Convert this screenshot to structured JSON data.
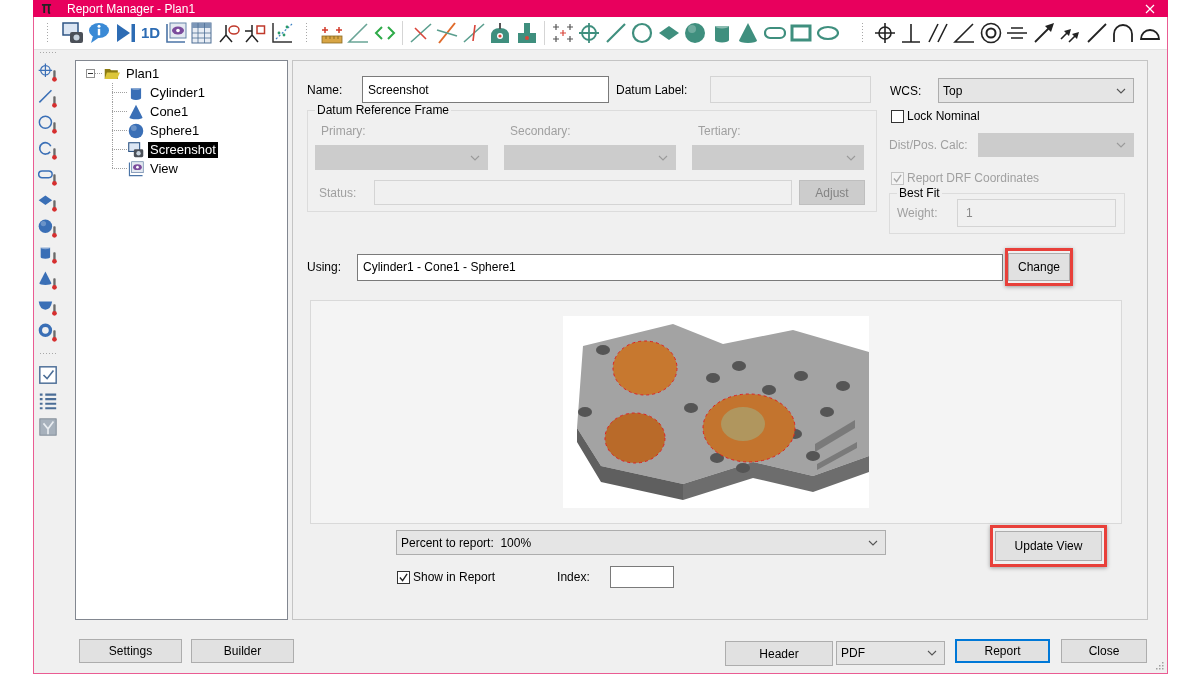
{
  "window": {
    "title": "Report Manager - Plan1"
  },
  "toolbar": {
    "one_d_button": "1D"
  },
  "tree": {
    "items": [
      {
        "label": "Plan1",
        "kind": "folder",
        "expanded": true,
        "selected": false,
        "children": [
          {
            "label": "Cylinder1",
            "kind": "cylinder",
            "selected": false
          },
          {
            "label": "Cone1",
            "kind": "cone",
            "selected": false
          },
          {
            "label": "Sphere1",
            "kind": "sphere",
            "selected": false
          },
          {
            "label": "Screenshot",
            "kind": "screenshot",
            "selected": true
          },
          {
            "label": "View",
            "kind": "view",
            "selected": false
          }
        ]
      }
    ]
  },
  "form": {
    "name": {
      "label": "Name:",
      "value": "Screenshot"
    },
    "datum_label": {
      "label": "Datum Label:",
      "disabled": true
    },
    "datum_reference_frame": {
      "title": "Datum Reference Frame",
      "disabled": true,
      "datums": [
        {
          "label": "Primary:"
        },
        {
          "label": "Secondary:"
        },
        {
          "label": "Tertiary:"
        }
      ],
      "status_label": "Status:",
      "adjust_button": "Adjust"
    },
    "wcs": {
      "label": "WCS:",
      "value": "Top"
    },
    "lock_nominal": {
      "label": "Lock Nominal",
      "checked": false
    },
    "dist_pos_calc": {
      "label": "Dist/Pos. Calc:",
      "disabled": true
    },
    "report_drf_coordinates": {
      "label": "Report DRF Coordinates",
      "checked": true,
      "disabled": true
    },
    "best_fit": {
      "title": "Best Fit",
      "weight_label": "Weight:",
      "weight_value": "1",
      "disabled": true
    },
    "using": {
      "label": "Using:",
      "value": "Cylinder1 - Cone1 - Sphere1"
    },
    "change_button": {
      "label": "Change",
      "highlighted": true
    },
    "percent_to_report": {
      "value": "Percent to report:  100%"
    },
    "update_view_button": {
      "label": "Update View",
      "highlighted": true
    },
    "show_in_report": {
      "label": "Show in Report",
      "checked": true
    },
    "index": {
      "label": "Index:"
    }
  },
  "footer": {
    "settings_button": "Settings",
    "builder_button": "Builder",
    "header_button": "Header",
    "format": "PDF",
    "report_button": {
      "label": "Report",
      "focused": true
    },
    "close_button": "Close"
  }
}
